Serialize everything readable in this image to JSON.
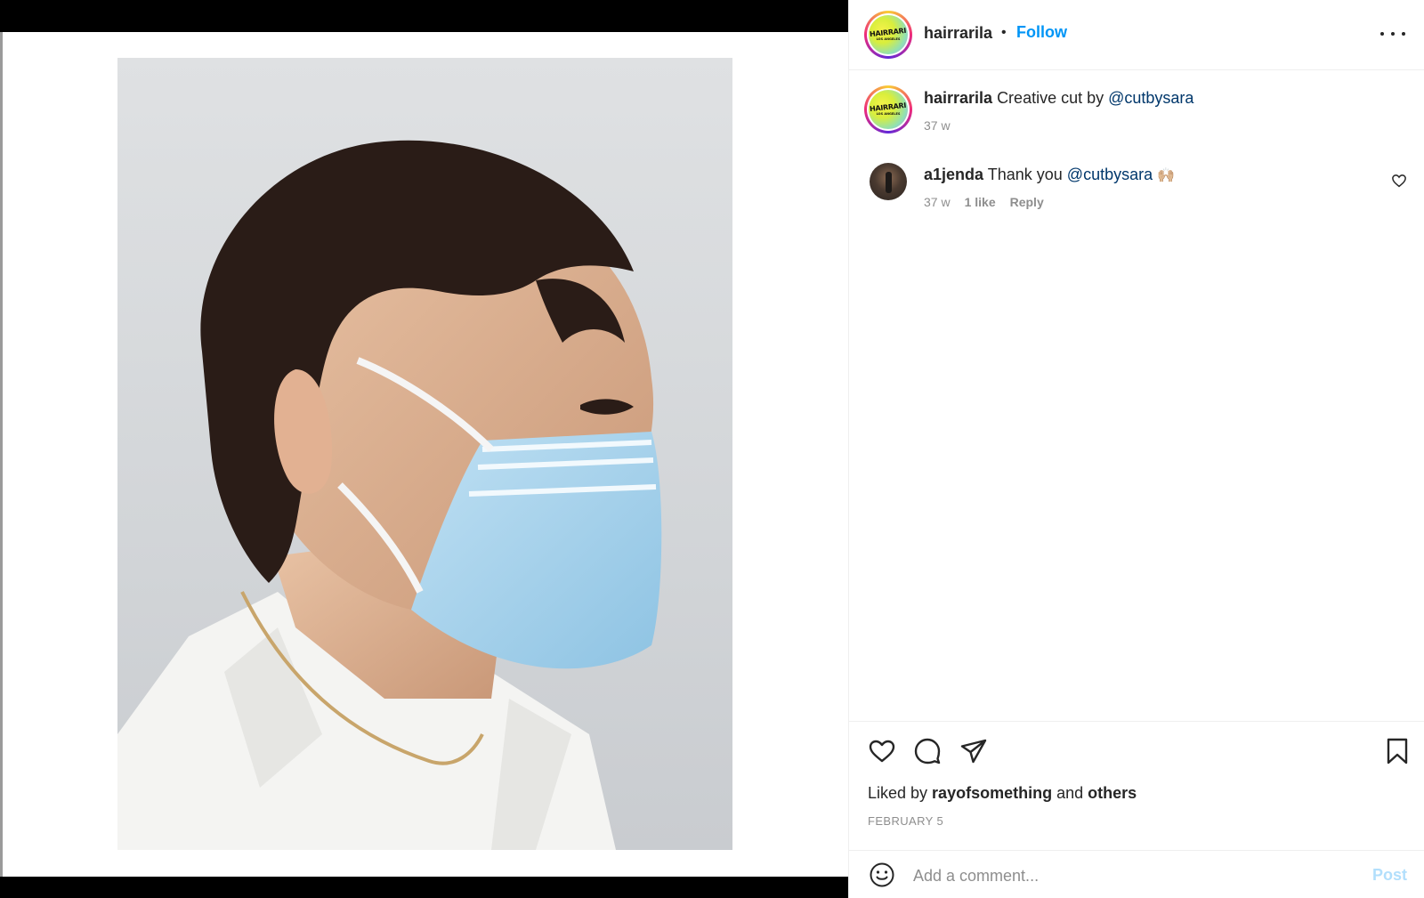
{
  "post": {
    "author": "hairrarila",
    "follow_label": "Follow",
    "separator": "•",
    "logo_text": "HAIRRARI",
    "logo_subtext": "LOS ANGELES",
    "caption": {
      "username": "hairrarila",
      "text": "Creative cut by ",
      "mention": "@cutbysara",
      "age": "37 w"
    },
    "comments": [
      {
        "username": "a1jenda",
        "text": "Thank you ",
        "mention": "@cutbysara",
        "emoji": "🙌🏼",
        "age": "37 w",
        "likes": "1 like",
        "reply_label": "Reply"
      }
    ],
    "liked_by": {
      "prefix": "Liked by ",
      "user": "rayofsomething",
      "middle": " and ",
      "others": "others"
    },
    "date": "FEBRUARY 5"
  },
  "composer": {
    "placeholder": "Add a comment...",
    "post_label": "Post"
  },
  "icons": [
    "more-options-icon",
    "heart-icon",
    "comment-icon",
    "share-icon",
    "bookmark-icon",
    "emoji-icon"
  ],
  "colors": {
    "link_blue": "#0095f6",
    "mention": "#00376b",
    "muted": "#8e8e8e",
    "post_disabled": "#b2dffc"
  }
}
